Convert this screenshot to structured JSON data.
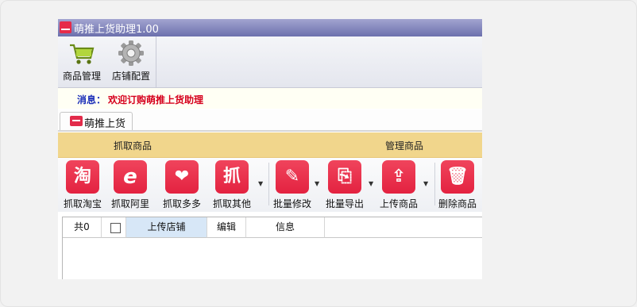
{
  "window": {
    "title": "萌推上货助理1.00"
  },
  "toolbar": {
    "items": [
      {
        "label": "商品管理",
        "icon": "cart-icon"
      },
      {
        "label": "店铺配置",
        "icon": "gear-icon"
      }
    ]
  },
  "message": {
    "label": "消息：",
    "text": "欢迎订购萌推上货助理"
  },
  "tab": {
    "label": "萌推上货"
  },
  "ribbon": {
    "group1": "抓取商品",
    "group2": "管理商品",
    "buttons": [
      {
        "label": "抓取淘宝",
        "glyph": "淘"
      },
      {
        "label": "抓取阿里",
        "glyph": "e"
      },
      {
        "label": "抓取多多",
        "glyph": "❤"
      },
      {
        "label": "抓取其他",
        "glyph": "抓"
      },
      {
        "label": "批量修改",
        "glyph": "✎"
      },
      {
        "label": "批量导出",
        "glyph": "⎘"
      },
      {
        "label": "上传商品",
        "glyph": "⇪"
      },
      {
        "label": "删除商品",
        "glyph": "🗑"
      }
    ]
  },
  "grid": {
    "count": "共0",
    "columns": [
      "上传店铺",
      "编辑",
      "信息"
    ]
  },
  "colors": {
    "accent": "#e62b4a",
    "ribbon_header": "#f1d68c",
    "titlebar": "#6c70ad"
  }
}
